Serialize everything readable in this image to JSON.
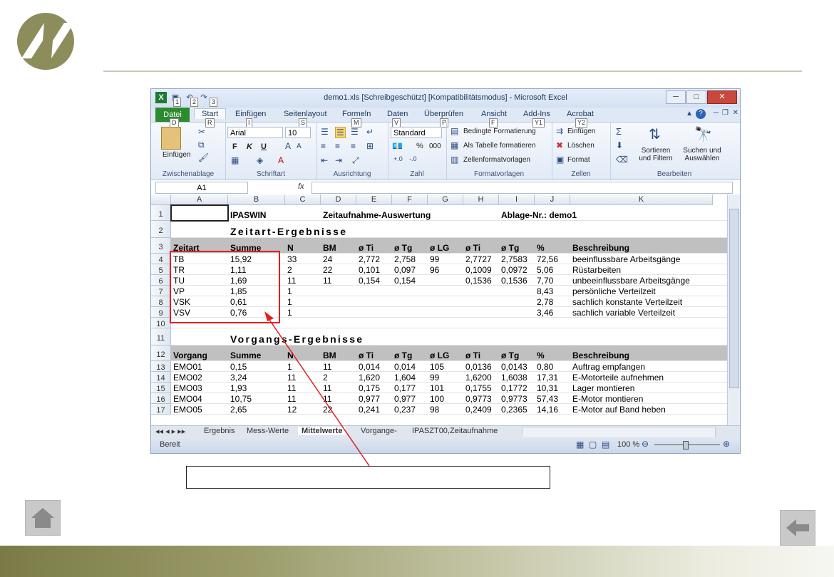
{
  "window": {
    "title": "demo1.xls  [Schreibgeschützt]  [Kompatibilitätsmodus]  -  Microsoft Excel",
    "qat_keytips": [
      "1",
      "2",
      "3"
    ]
  },
  "ribbon": {
    "tabs": [
      "Datei",
      "Start",
      "Einfügen",
      "Seitenlayout",
      "Formeln",
      "Daten",
      "Überprüfen",
      "Ansicht",
      "Add-Ins",
      "Acrobat"
    ],
    "keytips": [
      "D",
      "R",
      "I",
      "S",
      "M",
      "V",
      "P",
      "F",
      "Y1",
      "Y2"
    ],
    "groups": {
      "clipboard": {
        "label": "Zwischenablage",
        "paste": "Einfügen"
      },
      "font": {
        "label": "Schriftart",
        "font_name": "Arial",
        "font_size": "10",
        "bold": "F",
        "italic": "K",
        "underline": "U"
      },
      "alignment": {
        "label": "Ausrichtung"
      },
      "number": {
        "label": "Zahl",
        "format": "Standard",
        "percent": "%",
        "thousands": "000"
      },
      "styles": {
        "label": "Formatvorlagen",
        "conditional": "Bedingte Formatierung",
        "table": "Als Tabelle formatieren",
        "cellstyles": "Zellenformatvorlagen"
      },
      "cells": {
        "label": "Zellen",
        "insert": "Einfügen",
        "delete": "Löschen",
        "format": "Format"
      },
      "editing": {
        "label": "Bearbeiten",
        "sort": "Sortieren und Filtern",
        "find": "Suchen und Auswählen"
      }
    }
  },
  "formula_bar": {
    "name_box": "A1",
    "fx": "fx"
  },
  "columns": [
    "A",
    "B",
    "C",
    "D",
    "E",
    "F",
    "G",
    "H",
    "I",
    "J",
    "K"
  ],
  "rows": [
    {
      "n": "1",
      "type": "title",
      "cells": [
        "",
        "IPASWIN",
        "",
        "Zeitaufnahme-Auswertung",
        "",
        "",
        "",
        "",
        "Ablage-Nr.: demo1",
        "",
        ""
      ]
    },
    {
      "n": "2",
      "type": "section",
      "cells": [
        "",
        "Zeitart-Ergebnisse",
        "",
        "",
        "",
        "",
        "",
        "",
        "",
        "",
        ""
      ]
    },
    {
      "n": "3",
      "type": "header",
      "cells": [
        "Zeitart",
        "Summe",
        "N",
        "BM",
        "ø Ti",
        "ø Tg",
        "ø LG",
        "ø Ti",
        "ø Tg",
        "%",
        "Beschreibung"
      ]
    },
    {
      "n": "4",
      "type": "data",
      "cells": [
        "TB",
        "15,92",
        "33",
        "24",
        "2,772",
        "2,758",
        "99",
        "2,7727",
        "2,7583",
        "72,56",
        "beeinflussbare Arbeitsgänge"
      ]
    },
    {
      "n": "5",
      "type": "data",
      "cells": [
        "TR",
        "1,11",
        "2",
        "22",
        "0,101",
        "0,097",
        "96",
        "0,1009",
        "0,0972",
        "5,06",
        "Rüstarbeiten"
      ]
    },
    {
      "n": "6",
      "type": "data",
      "cells": [
        "TU",
        "1,69",
        "11",
        "11",
        "0,154",
        "0,154",
        "",
        "0,1536",
        "0,1536",
        "7,70",
        "unbeeinflussbare Arbeitsgänge"
      ]
    },
    {
      "n": "7",
      "type": "data",
      "cells": [
        "VP",
        "1,85",
        "1",
        "",
        "",
        "",
        "",
        "",
        "",
        "8,43",
        "persönliche Verteilzeit"
      ]
    },
    {
      "n": "8",
      "type": "data",
      "cells": [
        "VSK",
        "0,61",
        "1",
        "",
        "",
        "",
        "",
        "",
        "",
        "2,78",
        "sachlich konstante Verteilzeit"
      ]
    },
    {
      "n": "9",
      "type": "data",
      "cells": [
        "VSV",
        "0,76",
        "1",
        "",
        "",
        "",
        "",
        "",
        "",
        "3,46",
        "sachlich variable Verteilzeit"
      ]
    },
    {
      "n": "10",
      "type": "blank",
      "cells": [
        "",
        "",
        "",
        "",
        "",
        "",
        "",
        "",
        "",
        "",
        ""
      ]
    },
    {
      "n": "11",
      "type": "section",
      "cells": [
        "",
        "Vorgangs-Ergebnisse",
        "",
        "",
        "",
        "",
        "",
        "",
        "",
        "",
        ""
      ]
    },
    {
      "n": "12",
      "type": "header",
      "cells": [
        "Vorgang",
        "Summe",
        "N",
        "BM",
        "ø Ti",
        "ø Tg",
        "ø LG",
        "ø Ti",
        "ø Tg",
        "%",
        "Beschreibung"
      ]
    },
    {
      "n": "13",
      "type": "data",
      "cells": [
        "EMO01",
        "0,15",
        "1",
        "11",
        "0,014",
        "0,014",
        "105",
        "0,0136",
        "0,0143",
        "0,80",
        "Auftrag empfangen"
      ]
    },
    {
      "n": "14",
      "type": "data",
      "cells": [
        "EMO02",
        "3,24",
        "11",
        "2",
        "1,620",
        "1,604",
        "99",
        "1,6200",
        "1,6038",
        "17,31",
        "E-Motorteile aufnehmen"
      ]
    },
    {
      "n": "15",
      "type": "data",
      "cells": [
        "EMO03",
        "1,93",
        "11",
        "11",
        "0,175",
        "0,177",
        "101",
        "0,1755",
        "0,1772",
        "10,31",
        "Lager montieren"
      ]
    },
    {
      "n": "16",
      "type": "data",
      "cells": [
        "EMO04",
        "10,75",
        "11",
        "11",
        "0,977",
        "0,977",
        "100",
        "0,9773",
        "0,9773",
        "57,43",
        "E-Motor montieren"
      ]
    },
    {
      "n": "17",
      "type": "data",
      "cells": [
        "EMO05",
        "2,65",
        "12",
        "22",
        "0,241",
        "0,237",
        "98",
        "0,2409",
        "0,2365",
        "14,16",
        "E-Motor auf Band heben"
      ]
    }
  ],
  "sheet_tabs": [
    "Ergebnis",
    "Mess-Werte",
    "Mittelwerte",
    "Vorgange-",
    "IPASZT00,Zeitaufnahme"
  ],
  "active_sheet": "Mittelwerte",
  "status": {
    "ready": "Bereit",
    "zoom": "100 %"
  },
  "annotation": {
    "text": ""
  }
}
